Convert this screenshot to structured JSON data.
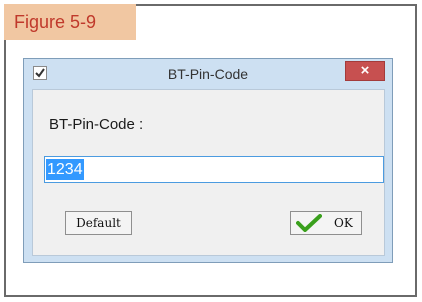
{
  "figure": {
    "label": "Figure 5-9"
  },
  "dialog": {
    "title": "BT-Pin-Code",
    "close_glyph": "×",
    "field_label": "BT-Pin-Code :",
    "pin_value": "1234",
    "buttons": {
      "default_label": "Default",
      "ok_label": "OK"
    },
    "icons": {
      "title_icon": "check-icon",
      "ok_icon": "green-check-icon"
    }
  },
  "colors": {
    "figure_label_bg": "#f1c7a2",
    "figure_label_text": "#c0392b",
    "titlebar": "#cde0f2",
    "close_button": "#c75050",
    "selection": "#3399ff",
    "check_green": "#3aa01d"
  }
}
